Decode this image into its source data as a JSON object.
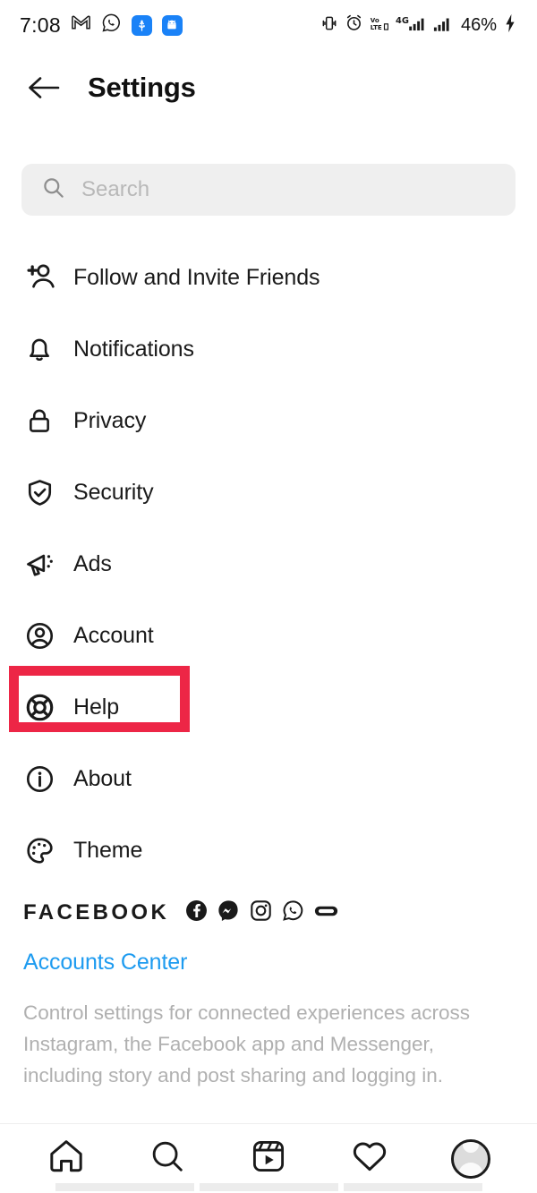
{
  "statusbar": {
    "time": "7:08",
    "battery": "46%",
    "left_icons": [
      "gmail-icon",
      "whatsapp-icon",
      "usb-icon",
      "android-icon"
    ],
    "right_icons": [
      "vibrate-icon",
      "alarm-icon",
      "volte-icon",
      "signal-4g-icon",
      "signal-bars-icon",
      "charging-bolt-icon"
    ]
  },
  "header": {
    "back_label": "back-arrow",
    "title": "Settings"
  },
  "search": {
    "placeholder": "Search",
    "value": ""
  },
  "menu": {
    "items": [
      {
        "label": "Follow and Invite Friends",
        "icon": "person-add-icon"
      },
      {
        "label": "Notifications",
        "icon": "bell-icon"
      },
      {
        "label": "Privacy",
        "icon": "lock-icon"
      },
      {
        "label": "Security",
        "icon": "shield-check-icon"
      },
      {
        "label": "Ads",
        "icon": "megaphone-icon"
      },
      {
        "label": "Account",
        "icon": "person-circle-icon"
      },
      {
        "label": "Help",
        "icon": "lifebuoy-icon"
      },
      {
        "label": "About",
        "icon": "info-circle-icon"
      },
      {
        "label": "Theme",
        "icon": "palette-icon"
      }
    ]
  },
  "highlight": {
    "target": "Help",
    "color": "#ed2646"
  },
  "facebook": {
    "title": "FACEBOOK",
    "icons": [
      "facebook-icon",
      "messenger-icon",
      "instagram-icon",
      "whatsapp-icon",
      "oculus-icon"
    ],
    "accounts_center_label": "Accounts Center",
    "accounts_center_color": "#1d9bf0",
    "description": "Control settings for connected experiences across Instagram, the Facebook app and Messenger, including story and post sharing and logging in."
  },
  "bottomnav": {
    "items": [
      {
        "name": "home",
        "icon": "home-icon"
      },
      {
        "name": "search",
        "icon": "search-icon"
      },
      {
        "name": "reels",
        "icon": "reels-icon"
      },
      {
        "name": "activity",
        "icon": "heart-icon"
      },
      {
        "name": "profile",
        "icon": "avatar-icon"
      }
    ]
  }
}
